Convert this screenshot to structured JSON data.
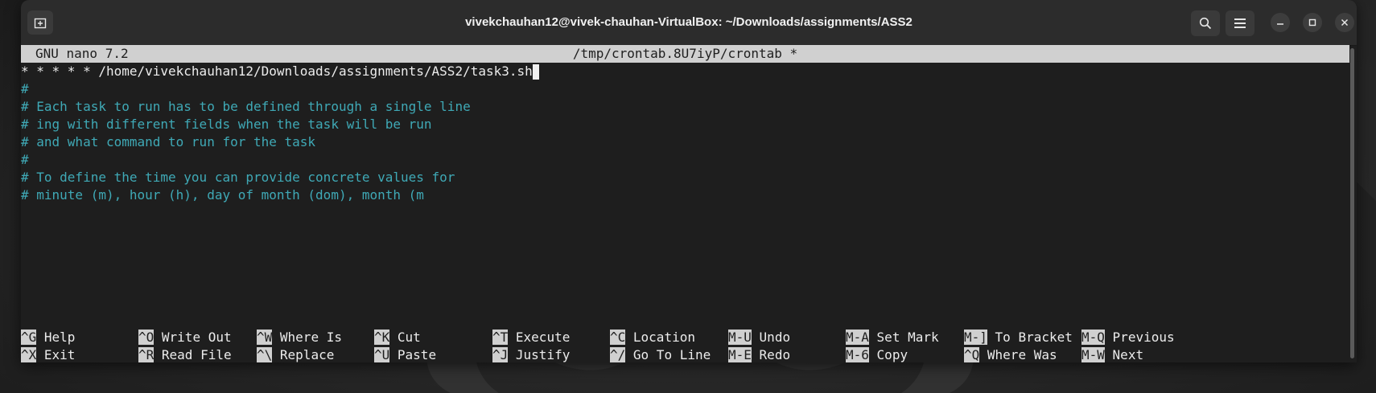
{
  "window": {
    "title": "vivekchauhan12@vivek-chauhan-VirtualBox: ~/Downloads/assignments/ASS2"
  },
  "editor": {
    "version": "GNU nano 7.2",
    "filename": "/tmp/crontab.8U7iyP/crontab *",
    "lines": [
      "* * * * * /home/vivekchauhan12/Downloads/assignments/ASS2/task3.sh",
      "",
      "#",
      "# Each task to run has to be defined through a single line",
      "# ing with different fields when the task will be run",
      "# and what command to run for the task",
      "#",
      "# To define the time you can provide concrete values for",
      "# minute (m), hour (h), day of month (dom), month (m"
    ]
  },
  "shortcuts": [
    {
      "key": "^G",
      "label": "Help"
    },
    {
      "key": "^X",
      "label": "Exit"
    },
    {
      "key": "^O",
      "label": "Write Out"
    },
    {
      "key": "^R",
      "label": "Read File"
    },
    {
      "key": "^W",
      "label": "Where Is"
    },
    {
      "key": "^\\",
      "label": "Replace"
    },
    {
      "key": "^K",
      "label": "Cut"
    },
    {
      "key": "^U",
      "label": "Paste"
    },
    {
      "key": "^T",
      "label": "Execute"
    },
    {
      "key": "^J",
      "label": "Justify"
    },
    {
      "key": "^C",
      "label": "Location"
    },
    {
      "key": "^/",
      "label": "Go To Line"
    },
    {
      "key": "M-U",
      "label": "Undo"
    },
    {
      "key": "M-E",
      "label": "Redo"
    },
    {
      "key": "M-A",
      "label": "Set Mark"
    },
    {
      "key": "M-6",
      "label": "Copy"
    },
    {
      "key": "M-]",
      "label": "To Bracket"
    },
    {
      "key": "^Q",
      "label": "Where Was"
    },
    {
      "key": "M-Q",
      "label": "Previous"
    },
    {
      "key": "M-W",
      "label": "Next"
    }
  ],
  "colors": {
    "comment": "#3fa9b6",
    "header_bg": "#d0d0d0",
    "terminal_bg": "#1e1e1e",
    "titlebar_bg": "#2c2c2c"
  },
  "icons": {
    "new_tab": "new-tab-icon",
    "search": "search-icon",
    "menu": "hamburger-menu-icon",
    "minimize": "minimize-icon",
    "maximize": "maximize-icon",
    "close": "close-icon"
  }
}
